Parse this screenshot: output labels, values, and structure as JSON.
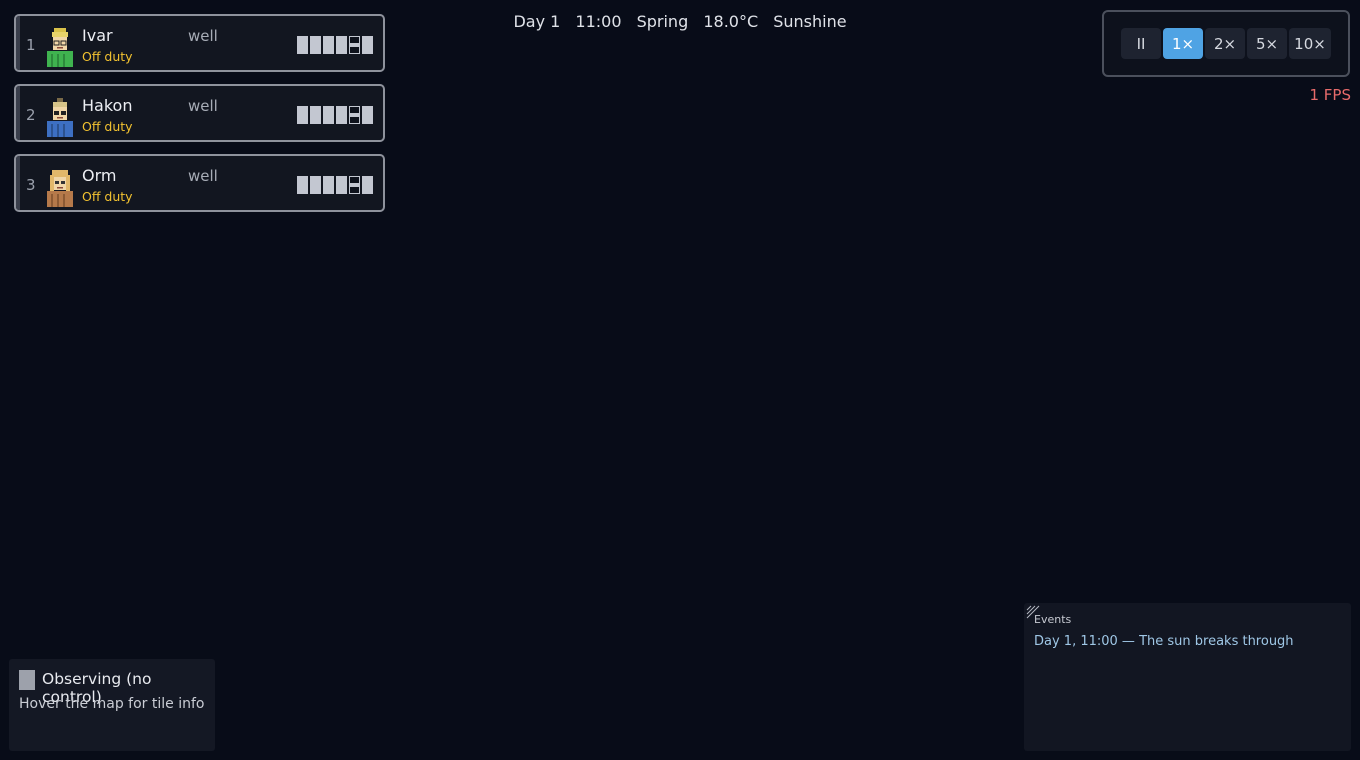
{
  "header": {
    "day": "Day 1",
    "time": "11:00",
    "season": "Spring",
    "temperature": "18.0°C",
    "weather": "Sunshine"
  },
  "colonists": [
    {
      "index": "1",
      "name": "Ivar",
      "status": "Off duty",
      "health": "well",
      "portrait_color": "#3fb34f",
      "bars": [
        "full",
        "full",
        "full",
        "full",
        "split",
        "full"
      ]
    },
    {
      "index": "2",
      "name": "Hakon",
      "status": "Off duty",
      "health": "well",
      "portrait_color": "#3d6fc2",
      "bars": [
        "full",
        "full",
        "full",
        "full",
        "split",
        "full"
      ]
    },
    {
      "index": "3",
      "name": "Orm",
      "status": "Off duty",
      "health": "well",
      "portrait_color": "#b5794a",
      "bars": [
        "full",
        "full",
        "full",
        "full",
        "split",
        "full"
      ]
    }
  ],
  "speed": {
    "buttons": [
      {
        "label": "II",
        "name": "pause-button"
      },
      {
        "label": "1×",
        "name": "speed-1x-button"
      },
      {
        "label": "2×",
        "name": "speed-2x-button"
      },
      {
        "label": "5×",
        "name": "speed-5x-button"
      },
      {
        "label": "10×",
        "name": "speed-10x-button"
      }
    ],
    "active": "1×",
    "active_color": "#4fa3e4"
  },
  "fps": "1 FPS",
  "observer": {
    "mode": "Observing (no control)",
    "hint": "Hover the map for tile info"
  },
  "events": {
    "title": "Events",
    "entries": [
      "Day 1, 11:00 — The sun breaks through"
    ]
  }
}
